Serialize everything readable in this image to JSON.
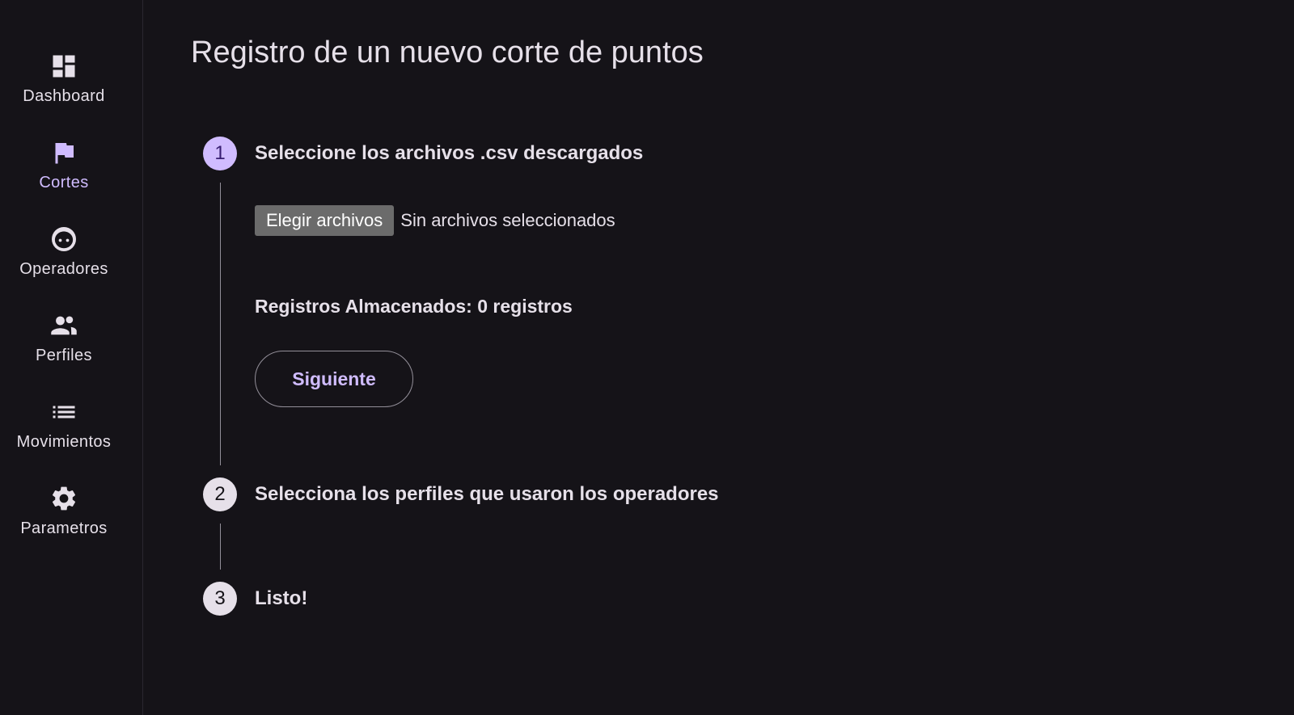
{
  "page": {
    "title": "Registro de un nuevo corte de puntos"
  },
  "nav": {
    "items": [
      {
        "label": "Dashboard",
        "icon": "dashboard-icon",
        "active": false
      },
      {
        "label": "Cortes",
        "icon": "flag-icon",
        "active": true
      },
      {
        "label": "Operadores",
        "icon": "face-icon",
        "active": false
      },
      {
        "label": "Perfiles",
        "icon": "people-icon",
        "active": false
      },
      {
        "label": "Movimientos",
        "icon": "list-icon",
        "active": false
      },
      {
        "label": "Parametros",
        "icon": "gear-icon",
        "active": false
      }
    ]
  },
  "stepper": {
    "steps": [
      {
        "number": "1",
        "title": "Seleccione los archivos .csv descargados",
        "active": true
      },
      {
        "number": "2",
        "title": "Selecciona los perfiles que usaron los operadores",
        "active": false
      },
      {
        "number": "3",
        "title": "Listo!",
        "active": false
      }
    ],
    "step1": {
      "file_button_label": "Elegir archivos",
      "file_status": "Sin archivos seleccionados",
      "stored_records": "Registros Almacenados: 0 registros",
      "next_label": "Siguiente"
    }
  },
  "colors": {
    "background": "#151318",
    "text": "#e6e0e9",
    "accent": "#d0bcff",
    "file_button": "#6b6b6b"
  }
}
